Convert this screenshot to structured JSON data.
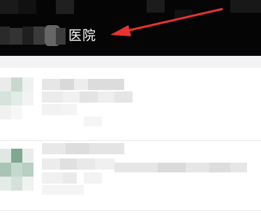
{
  "header": {
    "title": "医院"
  },
  "colors": {
    "header_bg": "#050505",
    "title_text": "#ffffff",
    "arrow": "#e8332e",
    "strip_bg": "#f3f3f5",
    "list_bg": "#ffffff",
    "divider": "#ececee"
  },
  "icons": {
    "annotation": "arrow-icon",
    "avatar": "avatar-placeholder-icon"
  },
  "list": {
    "items": [
      {
        "name": "conversation-item-1"
      },
      {
        "name": "conversation-item-2"
      }
    ]
  }
}
